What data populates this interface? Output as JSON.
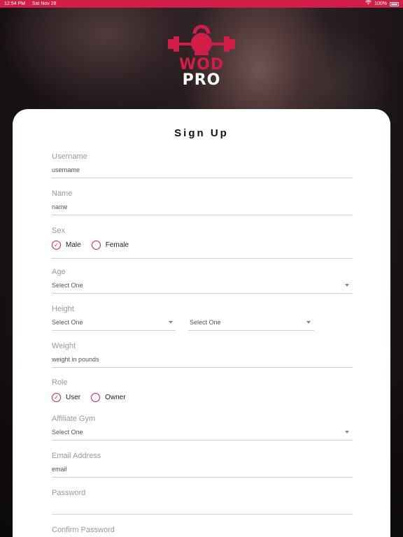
{
  "status_bar": {
    "time": "12:54 PM",
    "date": "Sat Nov 28",
    "battery_pct": "100%"
  },
  "logo": {
    "line1": "WOD",
    "line2": "PRO"
  },
  "colors": {
    "accent": "#d21d49"
  },
  "form": {
    "title": "Sign Up",
    "username": {
      "label": "Username",
      "placeholder": "username"
    },
    "name": {
      "label": "Name",
      "placeholder": "name"
    },
    "sex": {
      "label": "Sex",
      "options": [
        "Male",
        "Female"
      ],
      "selected": "Male"
    },
    "age": {
      "label": "Age",
      "placeholder": "Select One"
    },
    "height": {
      "label": "Height",
      "feet_placeholder": "Select One",
      "inches_placeholder": "Select One"
    },
    "weight": {
      "label": "Weight",
      "placeholder": "weight in pounds"
    },
    "role": {
      "label": "Role",
      "options": [
        "User",
        "Owner"
      ],
      "selected": "User"
    },
    "affiliate_gym": {
      "label": "Affiliate Gym",
      "placeholder": "Select One"
    },
    "email": {
      "label": "Email Address",
      "placeholder": "email"
    },
    "password": {
      "label": "Password",
      "placeholder": ""
    },
    "confirm_password": {
      "label": "Confirm Password",
      "placeholder": ""
    }
  }
}
